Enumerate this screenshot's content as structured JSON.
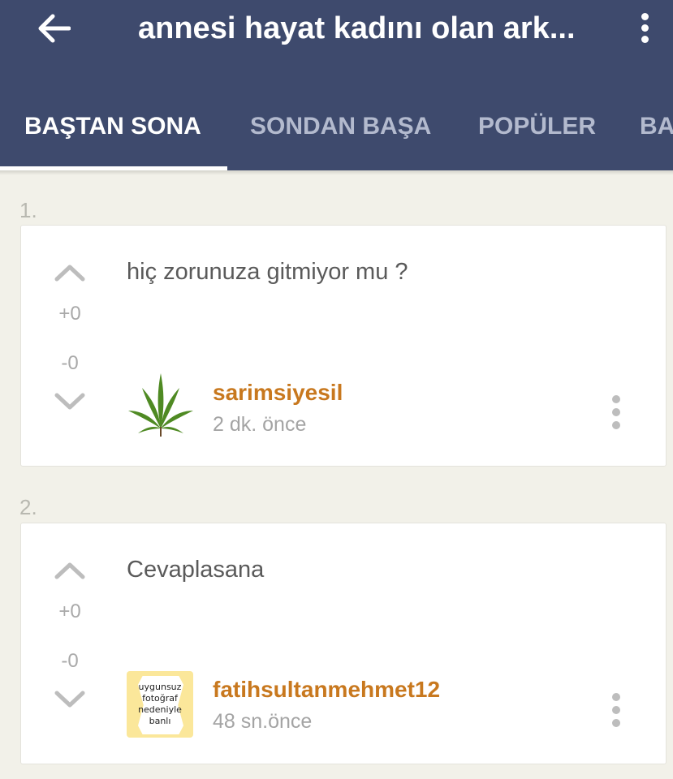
{
  "header": {
    "title": "annesi hayat kadını olan ark...",
    "back_icon": "arrow-left-icon",
    "menu_icon": "more-vertical-icon"
  },
  "tabs": [
    {
      "label": "BAŞTAN SONA",
      "active": true
    },
    {
      "label": "SONDAN BAŞA",
      "active": false
    },
    {
      "label": "POPÜLER",
      "active": false
    },
    {
      "label": "BA",
      "active": false
    }
  ],
  "entries": [
    {
      "number": "1.",
      "text": "hiç zorunuza gitmiyor mu ?",
      "upvotes": "+0",
      "downvotes": "-0",
      "author": "sarimsiyesil",
      "time": "2 dk. önce",
      "avatar": "cannabis-leaf-icon"
    },
    {
      "number": "2.",
      "text": "Cevaplasana",
      "upvotes": "+0",
      "downvotes": "-0",
      "author": "fatihsultanmehmet12",
      "time": "48 sn.önce",
      "avatar": "banned-avatar",
      "avatar_text": "uygunsuz fotoğraf nedeniyle banlı"
    }
  ],
  "colors": {
    "appbar": "#3e4a6d",
    "background": "#f2f1e9",
    "author": "#c8781e",
    "tab_inactive": "#b3bace"
  }
}
